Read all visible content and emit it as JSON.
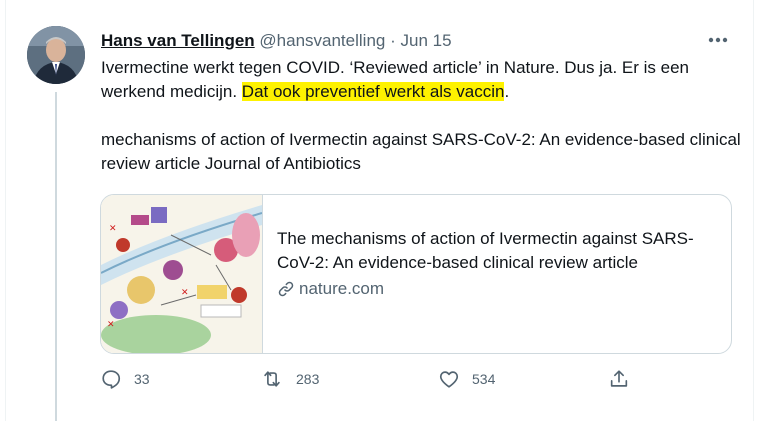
{
  "tweet": {
    "author_name": "Hans van Tellingen",
    "author_handle": "@hansvantelling",
    "separator": "·",
    "date": "Jun 15",
    "text_line1": "Ivermectine werkt tegen COVID. ‘Reviewed article’ in Nature. Dus ja. Er is een werkend medicijn.",
    "text_highlight": "Dat ook preventief werkt als vaccin",
    "text_end": ".",
    "text_paragraph2": "mechanisms of action of Ivermectin against SARS-CoV-2: An evidence-based clinical review article Journal of Antibiotics"
  },
  "card": {
    "title": "The mechanisms of action of Ivermectin against SARS-CoV-2: An evidence-based clinical review article",
    "domain": "nature.com"
  },
  "actions": {
    "reply_count": "33",
    "retweet_count": "283",
    "like_count": "534"
  },
  "colors": {
    "highlight": "#fef200",
    "secondary_text": "#536471",
    "border": "#cfd9de"
  },
  "icons": [
    "more-icon",
    "link-icon",
    "reply-icon",
    "retweet-icon",
    "like-icon",
    "share-icon"
  ]
}
